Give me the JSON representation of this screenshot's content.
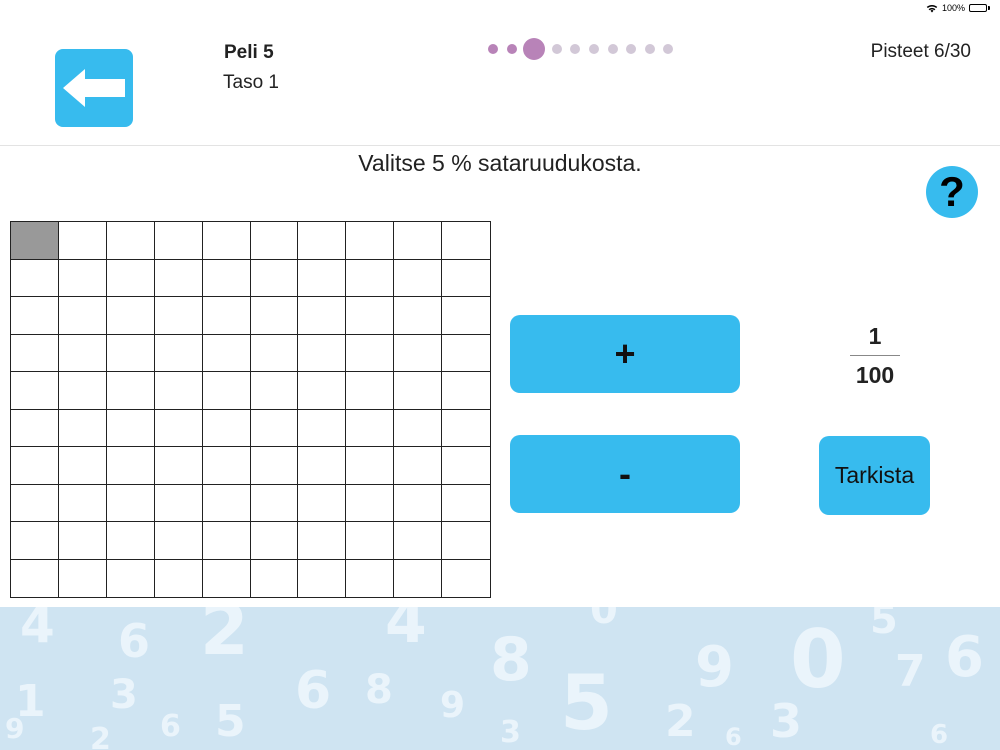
{
  "status_bar": {
    "battery": "100%"
  },
  "header": {
    "game_title": "Peli 5",
    "level_label": "Taso 1",
    "score": "Pisteet 6/30",
    "progress": {
      "total": 10,
      "current": 3
    }
  },
  "question": "Valitse 5 % sataruudukosta.",
  "help": {
    "label": "?"
  },
  "grid": {
    "rows": 10,
    "cols": 10,
    "selected_count": 1
  },
  "controls": {
    "plus_label": "+",
    "minus_label": "-",
    "check_label": "Tarkista"
  },
  "fraction": {
    "numerator": "1",
    "denominator": "100"
  },
  "colors": {
    "accent": "#37bbee",
    "dot_active": "#b883b8",
    "dot_inactive": "#d2c8d7",
    "selected_cell": "#999999",
    "footer_bg": "#cfe4f2"
  }
}
